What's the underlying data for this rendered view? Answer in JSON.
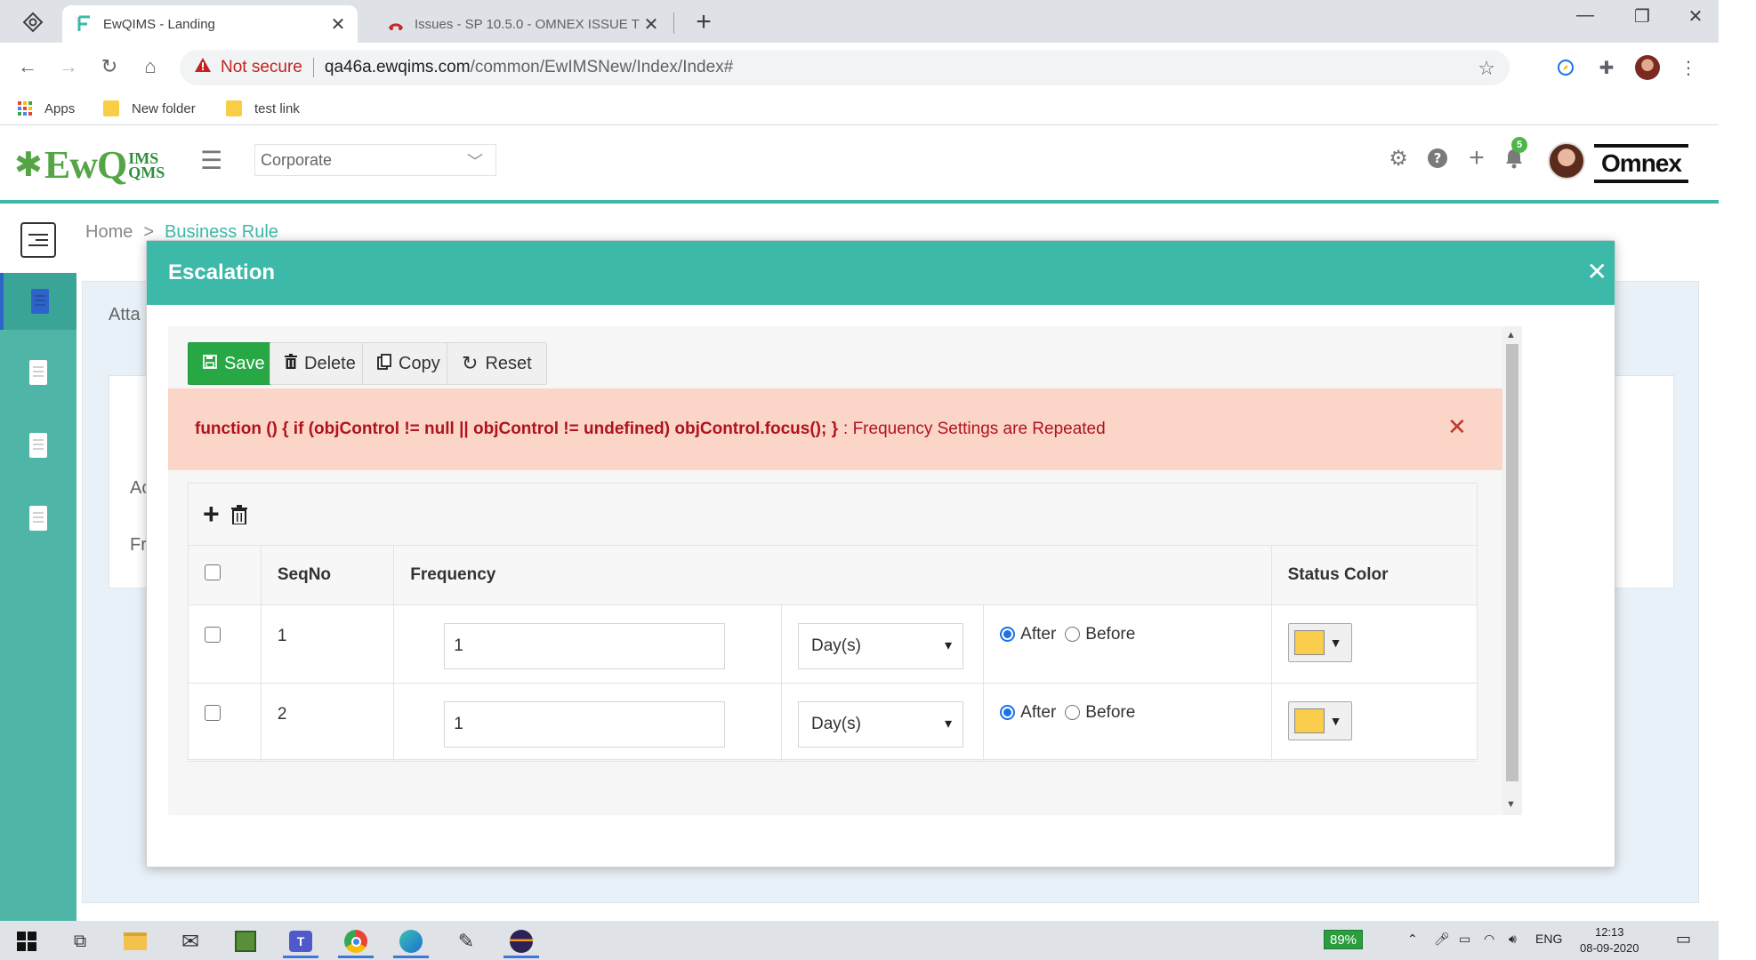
{
  "browser": {
    "tabs": [
      {
        "title": "EwQIMS - Landing",
        "active": true
      },
      {
        "title": "Issues - SP 10.5.0 - OMNEX ISSUE TF",
        "active": false
      }
    ],
    "security_label": "Not secure",
    "url_host": "qa46a.ewqims.com",
    "url_path": "/common/EwIMSNew/Index/Index#",
    "bookmarks": [
      "Apps",
      "New folder",
      "test link"
    ]
  },
  "header": {
    "logo_text": "EwQ",
    "logo_sub_top": "IMS",
    "logo_sub_bottom": "QMS",
    "org_select": "Corporate",
    "notifications_count": "5",
    "brand_right": "Omnex"
  },
  "breadcrumb": {
    "home": "Home",
    "separator": ">",
    "current": "Business Rule"
  },
  "background": {
    "label_attach": "Atta",
    "label_ac": "Ac",
    "label_fr": "Fr"
  },
  "modal": {
    "title": "Escalation",
    "buttons": {
      "save": "Save",
      "delete": "Delete",
      "copy": "Copy",
      "reset": "Reset"
    },
    "alert": {
      "code": "function () { if (objControl != null || objControl != undefined) objControl.focus(); }",
      "message": ": Frequency Settings are Repeated"
    },
    "table": {
      "headers": {
        "seq": "SeqNo",
        "frequency": "Frequency",
        "status_color": "Status Color"
      },
      "rows": [
        {
          "seq": "1",
          "value": "1",
          "unit": "Day(s)",
          "after": "After",
          "before": "Before",
          "selected": "After",
          "color": "#fbcd4c"
        },
        {
          "seq": "2",
          "value": "1",
          "unit": "Day(s)",
          "after": "After",
          "before": "Before",
          "selected": "After",
          "color": "#fbcd4c"
        }
      ]
    }
  },
  "taskbar": {
    "battery": "89%",
    "language": "ENG",
    "time": "12:13",
    "date": "08-09-2020"
  },
  "colors": {
    "teal": "#3cb9a9",
    "save_green": "#28a745",
    "alert_bg": "#fbd5c8",
    "alert_text": "#b0131e"
  }
}
